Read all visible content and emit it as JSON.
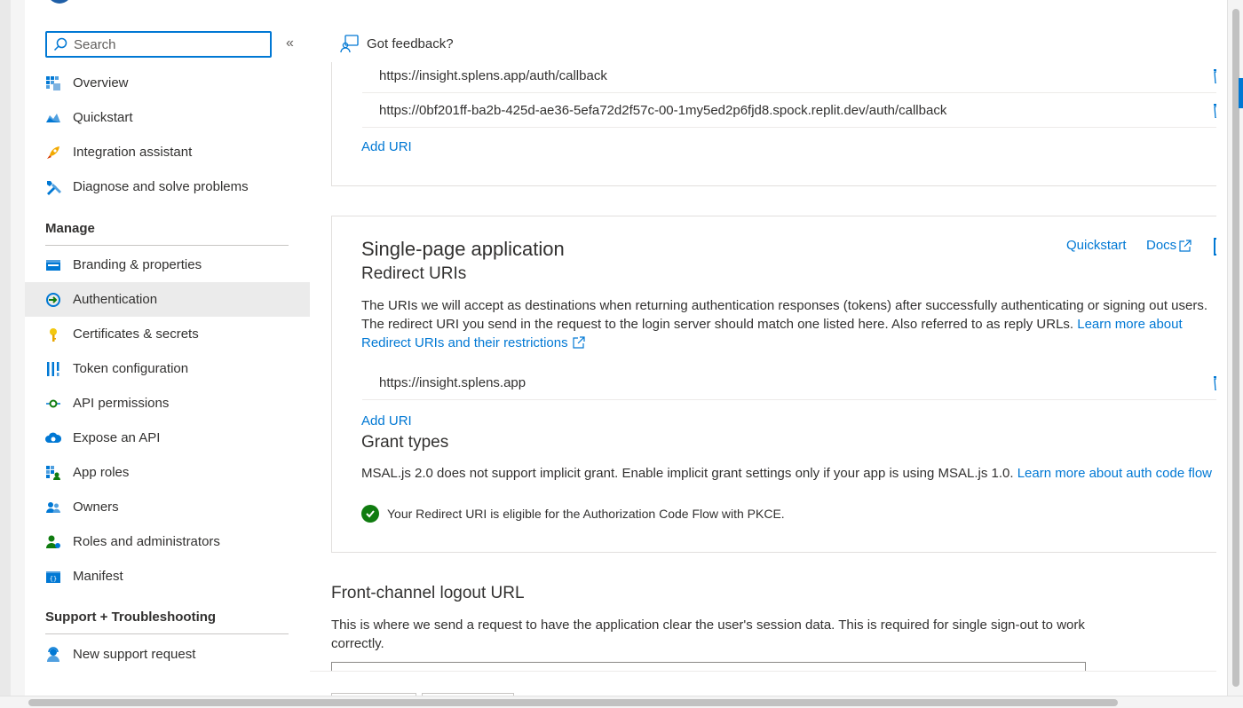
{
  "search": {
    "placeholder": "Search"
  },
  "sidebar": {
    "top_items": [
      {
        "label": "Overview",
        "icon": "overview-icon"
      },
      {
        "label": "Quickstart",
        "icon": "quickstart-icon"
      },
      {
        "label": "Integration assistant",
        "icon": "rocket-icon"
      },
      {
        "label": "Diagnose and solve problems",
        "icon": "wrench-icon"
      }
    ],
    "manage_heading": "Manage",
    "manage_items": [
      {
        "label": "Branding & properties",
        "icon": "branding-icon"
      },
      {
        "label": "Authentication",
        "icon": "authentication-icon",
        "selected": true
      },
      {
        "label": "Certificates & secrets",
        "icon": "key-icon"
      },
      {
        "label": "Token configuration",
        "icon": "token-icon"
      },
      {
        "label": "API permissions",
        "icon": "api-permissions-icon"
      },
      {
        "label": "Expose an API",
        "icon": "cloud-icon"
      },
      {
        "label": "App roles",
        "icon": "app-roles-icon"
      },
      {
        "label": "Owners",
        "icon": "owners-icon"
      },
      {
        "label": "Roles and administrators",
        "icon": "roles-icon"
      },
      {
        "label": "Manifest",
        "icon": "manifest-icon"
      }
    ],
    "support_heading": "Support + Troubleshooting",
    "support_items": [
      {
        "label": "New support request",
        "icon": "support-icon"
      }
    ]
  },
  "feedback": {
    "label": "Got feedback?"
  },
  "web_card": {
    "uris": [
      "https://insight.splens.app/auth/callback",
      "https://0bf201ff-ba2b-425d-ae36-5efa72d2f57c-00-1my5ed2p6fjd8.spock.replit.dev/auth/callback"
    ],
    "add_uri": "Add URI"
  },
  "spa_card": {
    "title": "Single-page application",
    "quickstart_link": "Quickstart",
    "docs_link": "Docs",
    "redirect_heading": "Redirect URIs",
    "description": "The URIs we will accept as destinations when returning authentication responses (tokens) after successfully authenticating or signing out users. The redirect URI you send in the request to the login server should match one listed here. Also referred to as reply URLs.",
    "learn_more": "Learn more about Redirect URIs and their restrictions",
    "uris": [
      "https://insight.splens.app"
    ],
    "add_uri": "Add URI",
    "grant_heading": "Grant types",
    "grant_text": "MSAL.js 2.0 does not support implicit grant. Enable implicit grant settings only if your app is using MSAL.js 1.0.",
    "grant_link": "Learn more about auth code flow",
    "eligible_text": "Your Redirect URI is eligible for the Authorization Code Flow with PKCE."
  },
  "logout": {
    "title": "Front-channel logout URL",
    "description": "This is where we send a request to have the application clear the user's session data. This is required for single sign-out to work correctly."
  },
  "colors": {
    "accent": "#0078d4",
    "success": "#107c10",
    "selected_bg": "#ebebeb"
  }
}
